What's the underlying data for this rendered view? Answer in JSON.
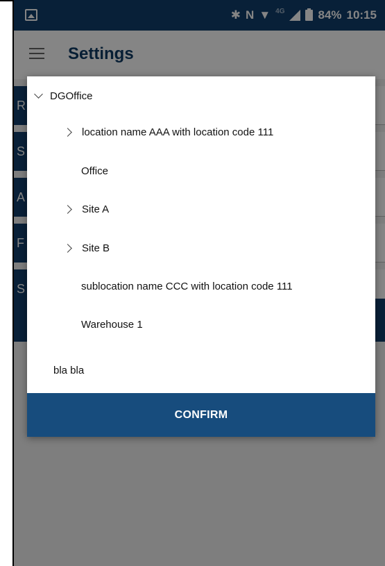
{
  "status_bar": {
    "bluetooth_icon": "bluetooth-icon",
    "nfc_icon": "nfc-icon",
    "wifi_icon": "wifi-icon",
    "network": "4G",
    "battery": "84%",
    "time": "10:15"
  },
  "app_bar": {
    "title": "Settings"
  },
  "background_rows": [
    {
      "initial": "R"
    },
    {
      "initial": "S"
    },
    {
      "initial": "A"
    },
    {
      "initial": "F"
    },
    {
      "initial": "S"
    }
  ],
  "dialog": {
    "tree": [
      {
        "label": "DGOffice",
        "expander": "chevron-down"
      },
      {
        "label": "location name AAA with location code 111",
        "expander": "chevron-right"
      },
      {
        "label": "Office",
        "expander": ""
      },
      {
        "label": "Site A",
        "expander": "chevron-right"
      },
      {
        "label": "Site B",
        "expander": "chevron-right"
      },
      {
        "label": "sublocation name CCC with location code 111",
        "expander": ""
      },
      {
        "label": "Warehouse 1",
        "expander": ""
      },
      {
        "label": "bla bla",
        "expander": ""
      }
    ],
    "confirm_label": "CONFIRM"
  },
  "colors": {
    "primary": "#123f6b",
    "confirm": "#174c7d",
    "title": "#0f3a64"
  }
}
